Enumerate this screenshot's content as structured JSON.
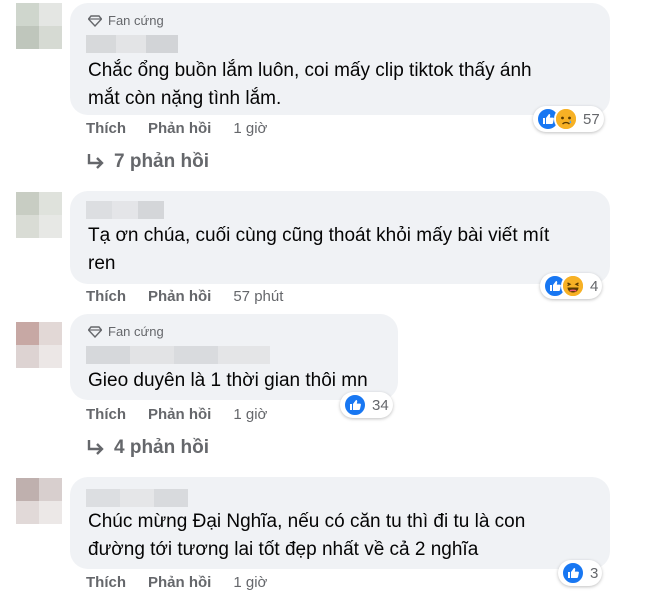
{
  "comments": [
    {
      "badge": "Fan cứng",
      "text_lines": [
        "Chắc ổng buồn lắm luôn, coi mấy clip tiktok thấy ánh",
        "mắt còn nặng tình lắm."
      ],
      "like_label": "Thích",
      "reply_label": "Phản hồi",
      "time": "1 giờ",
      "reactions": [
        "like-icon",
        "sad-icon"
      ],
      "reaction_count": "57",
      "replies_label": "7 phản hồi"
    },
    {
      "badge": "",
      "text_lines": [
        "Tạ ơn chúa, cuối cùng cũng thoát khỏi mấy bài viết mít",
        "ren"
      ],
      "like_label": "Thích",
      "reply_label": "Phản hồi",
      "time": "57 phút",
      "reactions": [
        "like-icon",
        "haha-icon"
      ],
      "reaction_count": "4",
      "replies_label": ""
    },
    {
      "badge": "Fan cứng",
      "text_lines": [
        "Gieo duyên là 1 thời gian thôi mn"
      ],
      "like_label": "Thích",
      "reply_label": "Phản hồi",
      "time": "1 giờ",
      "reactions": [
        "like-icon"
      ],
      "reaction_count": "34",
      "replies_label": "4 phản hồi"
    },
    {
      "badge": "",
      "text_lines": [
        "Chúc mừng Đại Nghĩa, nếu có căn tu thì đi tu là con",
        "đường tới tương lai tốt đẹp nhất về cả 2 nghĩa"
      ],
      "like_label": "Thích",
      "reply_label": "Phản hồi",
      "time": "1 giờ",
      "reactions": [
        "like-icon"
      ],
      "reaction_count": "3",
      "replies_label": ""
    }
  ],
  "colors": {
    "bubble": "#f0f2f5",
    "secondary_text": "#65676b",
    "like_blue": "#1877f2",
    "emoji_yellow": "#f7b125"
  }
}
